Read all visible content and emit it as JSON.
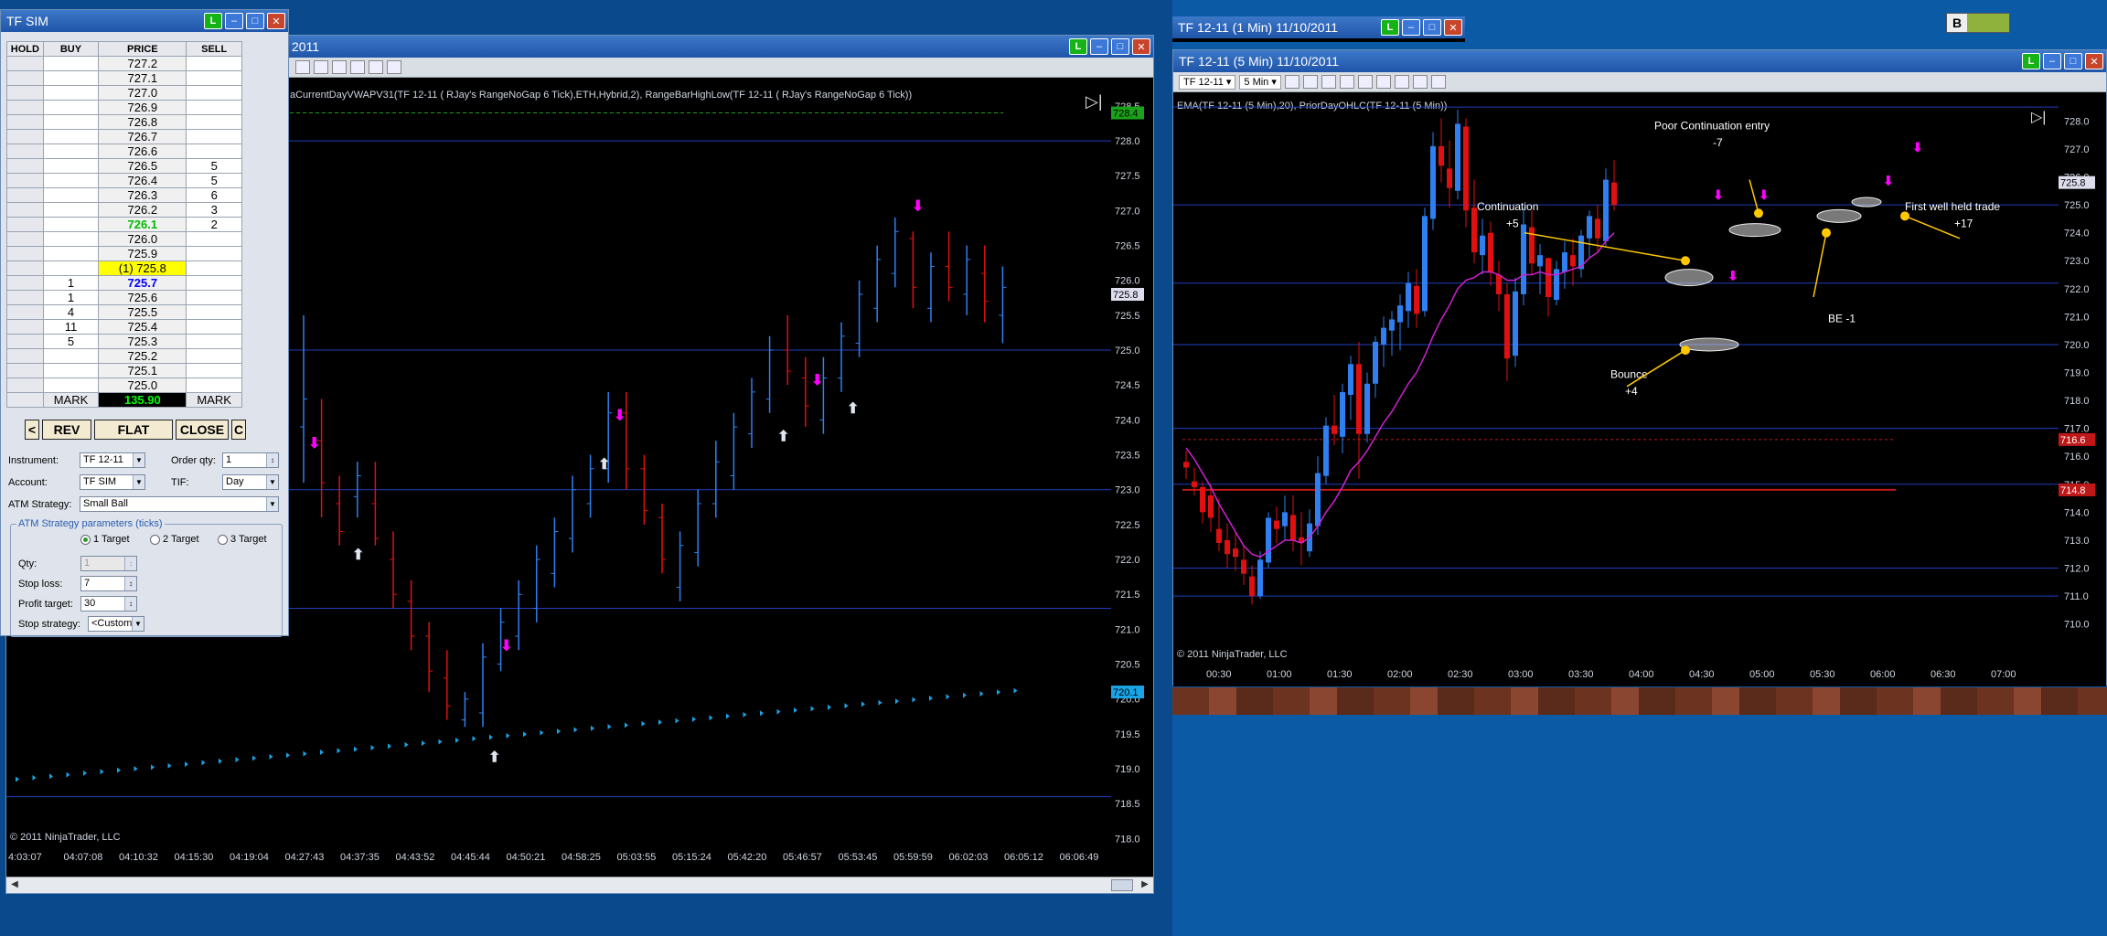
{
  "dom": {
    "title": "TF SIM",
    "live_badge": "L",
    "headers": {
      "hold": "HOLD",
      "buy": "BUY",
      "price": "PRICE",
      "sell": "SELL"
    },
    "rows": [
      {
        "buy": "",
        "price": "727.2",
        "sell": ""
      },
      {
        "buy": "",
        "price": "727.1",
        "sell": ""
      },
      {
        "buy": "",
        "price": "727.0",
        "sell": ""
      },
      {
        "buy": "",
        "price": "726.9",
        "sell": ""
      },
      {
        "buy": "",
        "price": "726.8",
        "sell": ""
      },
      {
        "buy": "",
        "price": "726.7",
        "sell": ""
      },
      {
        "buy": "",
        "price": "726.6",
        "sell": ""
      },
      {
        "buy": "",
        "price": "726.5",
        "sell": "5"
      },
      {
        "buy": "",
        "price": "726.4",
        "sell": "5"
      },
      {
        "buy": "",
        "price": "726.3",
        "sell": "6"
      },
      {
        "buy": "",
        "price": "726.2",
        "sell": "3"
      },
      {
        "buy": "",
        "price": "726.1",
        "sell": "2"
      },
      {
        "buy": "",
        "price": "726.0",
        "sell": ""
      },
      {
        "buy": "",
        "price": "725.9",
        "sell": ""
      },
      {
        "buy": "",
        "price": "(1) 725.8",
        "sell": ""
      },
      {
        "buy": "1",
        "price": "725.7",
        "sell": ""
      },
      {
        "buy": "1",
        "price": "725.6",
        "sell": ""
      },
      {
        "buy": "4",
        "price": "725.5",
        "sell": ""
      },
      {
        "buy": "11",
        "price": "725.4",
        "sell": ""
      },
      {
        "buy": "5",
        "price": "725.3",
        "sell": ""
      },
      {
        "buy": "",
        "price": "725.2",
        "sell": ""
      },
      {
        "buy": "",
        "price": "725.1",
        "sell": ""
      },
      {
        "buy": "",
        "price": "725.0",
        "sell": ""
      }
    ],
    "mark_left": "MARK",
    "pnl": "135.90",
    "mark_right": "MARK",
    "buttons": {
      "left": "<",
      "rev": "REV",
      "flat": "FLAT",
      "close": "CLOSE",
      "right": "C"
    },
    "form": {
      "instrument_label": "Instrument:",
      "instrument": "TF 12-11",
      "order_qty_label": "Order qty:",
      "order_qty": "1",
      "account_label": "Account:",
      "account": "TF SIM",
      "tif_label": "TIF:",
      "tif": "Day",
      "atm_label": "ATM Strategy:",
      "atm": "Small Ball",
      "group_label": "ATM Strategy parameters (ticks)",
      "t1": "1 Target",
      "t2": "2 Target",
      "t3": "3 Target",
      "qty_label": "Qty:",
      "qty": "1",
      "stop_label": "Stop loss:",
      "stop": "7",
      "profit_label": "Profit target:",
      "profit": "30",
      "strategy_label": "Stop strategy:",
      "strategy": "<Custom"
    }
  },
  "left_chart": {
    "title": "2011",
    "live_badge": "L",
    "indicator_text": "aCurrentDayVWAPV31(TF 12-11 ( RJay's RangeNoGap  6 Tick),ETH,Hybrid,2), RangeBarHighLow(TF 12-11 ( RJay's RangeNoGap  6 Tick))",
    "copyright": "© 2011 NinjaTrader, LLC",
    "y_ticks": [
      "728.5",
      "728.0",
      "727.5",
      "727.0",
      "726.5",
      "726.0",
      "725.5",
      "725.0",
      "724.5",
      "724.0",
      "723.5",
      "723.0",
      "722.5",
      "722.0",
      "721.5",
      "721.0",
      "720.5",
      "720.0",
      "719.5",
      "719.0",
      "718.5",
      "718.0"
    ],
    "price_tags": [
      "728.4",
      "725.8",
      "720.1"
    ],
    "x_ticks": [
      "4:03:07",
      "04:07:08",
      "04:10:32",
      "04:15:30",
      "04:19:04",
      "04:27:43",
      "04:37:35",
      "04:43:52",
      "04:45:44",
      "04:50:21",
      "04:58:25",
      "05:03:55",
      "05:15:24",
      "05:42:20",
      "05:46:57",
      "05:53:45",
      "05:59:59",
      "06:02:03",
      "06:05:12",
      "06:06:49"
    ]
  },
  "one_min": {
    "title": "TF 12-11 (1 Min)  11/10/2011",
    "live_badge": "L"
  },
  "right_chart": {
    "title": "TF 12-11 (5 Min)  11/10/2011",
    "live_badge": "L",
    "instrument_select": "TF 12-11",
    "period_select": "5 Min",
    "indicator_text": "EMA(TF 12-11 (5 Min),20), PriorDayOHLC(TF 12-11 (5 Min))",
    "copyright": "© 2011 NinjaTrader, LLC",
    "y_ticks": [
      "728.0",
      "727.0",
      "726.0",
      "725.0",
      "724.0",
      "723.0",
      "722.0",
      "721.0",
      "720.0",
      "719.0",
      "718.0",
      "717.0",
      "716.0",
      "715.0",
      "714.0",
      "713.0",
      "712.0",
      "711.0",
      "710.0"
    ],
    "price_tags": [
      "725.8",
      "716.6",
      "714.8"
    ],
    "x_ticks": [
      "00:30",
      "01:00",
      "01:30",
      "02:00",
      "02:30",
      "03:00",
      "03:30",
      "04:00",
      "04:30",
      "05:00",
      "05:30",
      "06:00",
      "06:30",
      "07:00"
    ],
    "annotations": {
      "poor": "Poor Continuation entry",
      "poor_val": "-7",
      "cont": "Continuation",
      "cont_val": "+5",
      "first": "First well held trade",
      "first_val": "+17",
      "be": "BE -1",
      "bounce": "Bounce",
      "bounce_val": "+4"
    }
  },
  "taskbar_badge": "B",
  "colors": {
    "up": "#2f7ff0",
    "down": "#e01010",
    "ema": "#d020d0",
    "grid": "#1f3fbf",
    "marker": "#ff00ff",
    "arrow": "#ffc800"
  }
}
